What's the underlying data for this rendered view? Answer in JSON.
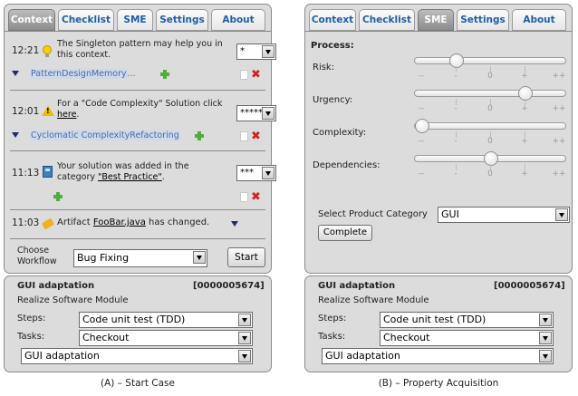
{
  "tabs": [
    "Context",
    "Checklist",
    "SME",
    "Settings",
    "About"
  ],
  "panel_a": {
    "caption": "(A) – Start Case",
    "active_tab": "Context",
    "items": [
      {
        "time": "12:21",
        "icon": "lightbulb-icon",
        "text": "The Singleton pattern may help you in this context.",
        "rating": "*",
        "tags": "PatternDesignMemory",
        "tag_suffix": "..."
      },
      {
        "time": "12:01",
        "icon": "warning-icon",
        "text_prefix": "For a \"Code Complexity\" Solution click ",
        "link": "here",
        "text_suffix": ".",
        "rating": "*****",
        "tags": "Cyclomatic ComplexityRefactoring"
      },
      {
        "time": "11:13",
        "icon": "calculator-icon",
        "text_prefix": "Your solution was added in the category ",
        "link": "\"Best Practice\"",
        "text_suffix": ".",
        "rating": "***"
      },
      {
        "time": "11:03",
        "icon": "brush-icon",
        "text_prefix": "Artifact ",
        "link": "FooBar.java",
        "text_suffix": " has changed."
      }
    ],
    "workflow_label": "Choose Workflow",
    "workflow_value": "Bug Fixing",
    "start_label": "Start"
  },
  "panel_b": {
    "caption": "(B) – Property Acquisition",
    "active_tab": "SME",
    "process_label": "Process:",
    "scale_labels": [
      "--",
      "-",
      "0",
      "+",
      "++"
    ],
    "sliders": [
      {
        "label": "Risk:",
        "value": -1
      },
      {
        "label": "Urgency:",
        "value": 1
      },
      {
        "label": "Complexity:",
        "value": -2
      },
      {
        "label": "Dependencies:",
        "value": 0
      }
    ],
    "category_label": "Select Product Category",
    "category_value": "GUI",
    "complete_label": "Complete"
  },
  "task_panel": {
    "title": "GUI adaptation",
    "id": "[0000005674]",
    "subtitle": "Realize Software Module",
    "steps_label": "Steps:",
    "steps_value": "Code unit test (TDD)",
    "tasks_label": "Tasks:",
    "tasks_value": "Checkout",
    "bottom_value": "GUI adaptation"
  }
}
